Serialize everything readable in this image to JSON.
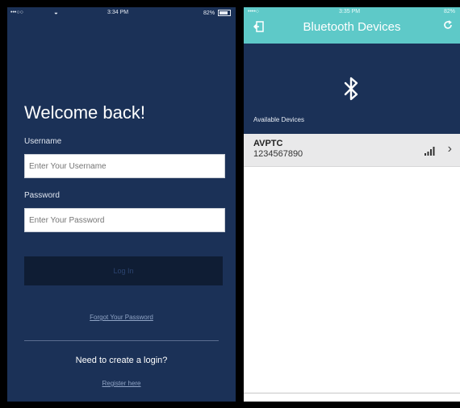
{
  "login_screen": {
    "status_bar": {
      "signal": "•••○○",
      "time": "3:34 PM",
      "battery": "82%"
    },
    "title": "Welcome back!",
    "username": {
      "label": "Username",
      "placeholder": "Enter Your Username"
    },
    "password": {
      "label": "Password",
      "placeholder": "Enter Your Password"
    },
    "login_button": "Log In",
    "forgot_link": "Forgot Your Password",
    "register_prompt": "Need to create a login?",
    "register_link": "Register here",
    "colors": {
      "background": "#1b3157",
      "button": "#0f1d34",
      "link": "#8fa3c4"
    }
  },
  "bluetooth_screen": {
    "status_bar": {
      "signal": "••••○",
      "time": "3:35 PM",
      "battery": "82%"
    },
    "title": "Bluetooth Devices",
    "icons": {
      "back": "back-icon",
      "refresh": "refresh-icon",
      "bluetooth": "bluetooth-icon",
      "signal": "signal-strength-icon",
      "chevron": "chevron-right-icon"
    },
    "available_label": "Available Devices",
    "devices": [
      {
        "name": "AVPTC",
        "id": "1234567890"
      }
    ],
    "colors": {
      "header": "#5ec9c8",
      "panel": "#1b3157",
      "row": "#e9e9ea"
    }
  }
}
